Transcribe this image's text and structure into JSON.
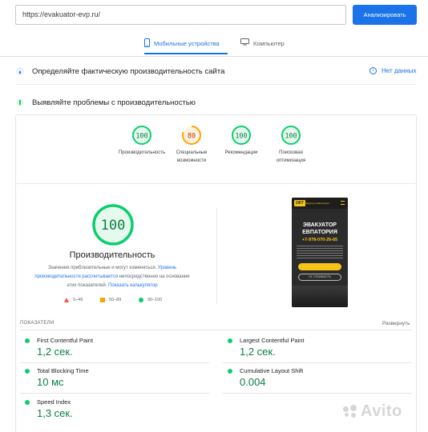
{
  "url_input": {
    "value": "https://evakuator-evp.ru/"
  },
  "analyze_button": "Анализировать",
  "tabs": [
    {
      "label": "Мобильные устройства",
      "icon": "smartphone-icon",
      "active": true
    },
    {
      "label": "Компьютер",
      "icon": "desktop-icon",
      "active": false
    }
  ],
  "field_data": {
    "title": "Определяйте фактическую производительность сайта",
    "no_data": "Нет данных"
  },
  "diagnostics": {
    "title": "Выявляйте проблемы с производительностью"
  },
  "categories": [
    {
      "score": "100",
      "label": "Производительность",
      "color": "#0cce6b"
    },
    {
      "score": "80",
      "label": "Специальные возможности",
      "color": "#ffa400"
    },
    {
      "score": "100",
      "label": "Рекомендации",
      "color": "#0cce6b"
    },
    {
      "score": "100",
      "label": "Поисковая оптимизация",
      "color": "#0cce6b"
    }
  ],
  "performance": {
    "score": "100",
    "title": "Производительность",
    "desc_prefix": "Значения приблизительные и могут изменяться. ",
    "desc_link1": "Уровень производительности рассчитывается",
    "desc_middle": " непосредственно на основании этих показателей. ",
    "desc_link2": "Показать калькулятор",
    "legend": [
      {
        "range": "0–49",
        "shape": "triangle",
        "color": "#ff4e42"
      },
      {
        "range": "50–89",
        "shape": "square",
        "color": "#ffa400"
      },
      {
        "range": "90–100",
        "shape": "circle",
        "color": "#0cce6b"
      }
    ]
  },
  "screenshot": {
    "logo": "24/7",
    "slogan": "Эвакуатор в Евпатории",
    "heading_line1": "ЭВАКУАТОР",
    "heading_line2": "ЕВПАТОРИЯ",
    "phone": "+7-978-070-26-65",
    "cost_button": "УЗ. СТОИМОСТЬ"
  },
  "metrics_header": {
    "label": "ПОКАЗАТЕЛИ",
    "expand": "Развернуть"
  },
  "metrics": [
    {
      "name": "First Contentful Paint",
      "value": "1,2 сек."
    },
    {
      "name": "Largest Contentful Paint",
      "value": "1,2 сек."
    },
    {
      "name": "Total Blocking Time",
      "value": "10 мс"
    },
    {
      "name": "Cumulative Layout Shift",
      "value": "0.004"
    },
    {
      "name": "Speed Index",
      "value": "1,3 сек."
    }
  ],
  "watermark": "Avito",
  "colors": {
    "accent": "#1a73e8",
    "pass": "#0cce6b",
    "average": "#ffa400",
    "fail": "#ff4e42",
    "pass_text": "#0a8043"
  }
}
